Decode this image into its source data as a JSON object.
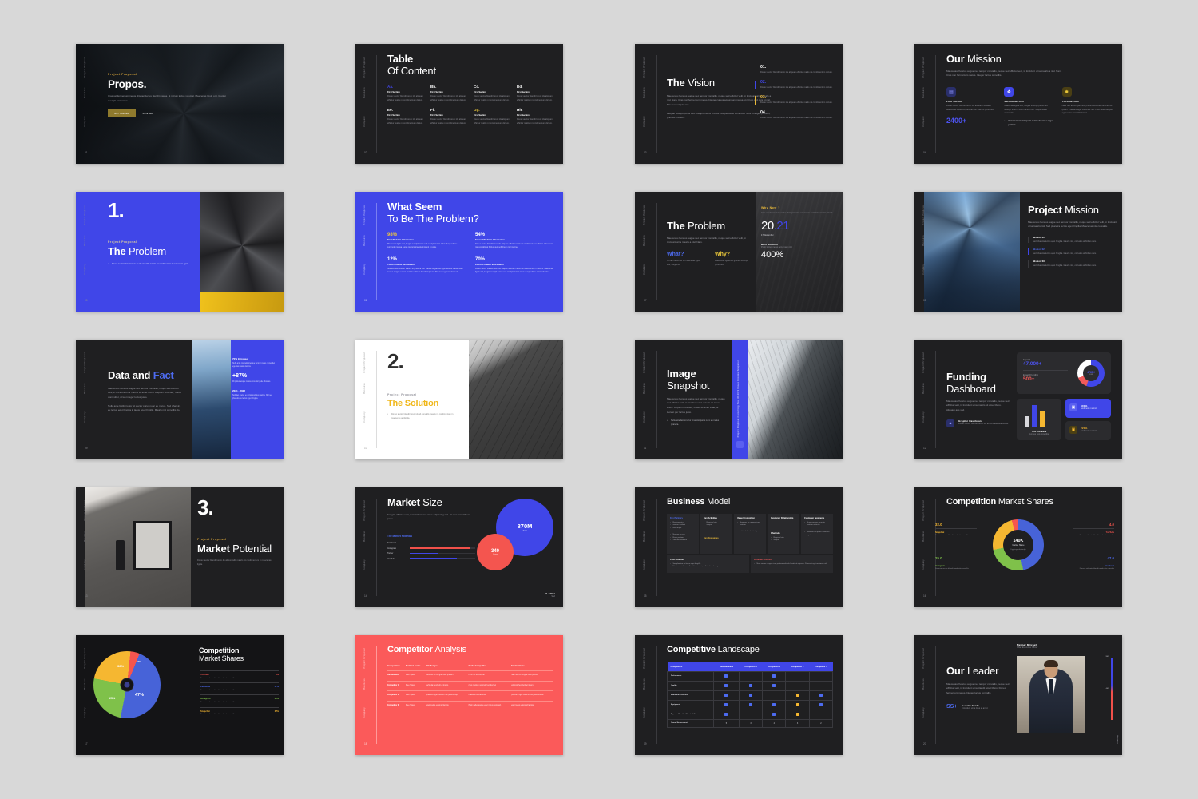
{
  "deck": {
    "rail_labels": [
      "Project Proposal",
      "Business",
      "Company"
    ],
    "slides": [
      {
        "n": "01",
        "eyebrow": "Project Proposal",
        "title": "Propos.",
        "para": "Cras vel fermentum metus. Integer luctus blandit massa, ut rutrum lectus volutpat. Maecenas ligula orci, feugiat suscipit accumsan.",
        "btn_primary": "Get Started",
        "btn_secondary": "Lets Go"
      },
      {
        "n": "02",
        "title_bold": "Table",
        "title_light": "Of Content",
        "items": [
          {
            "key": "Aa.",
            "color": "b",
            "sub": "First Section",
            "text": "Donec auctor blandit lorem ids aliquam efficitur mattis mi condimentum dictum."
          },
          {
            "key": "Bb.",
            "color": "w",
            "sub": "First Section",
            "text": "Donec auctor blandit lorem ids aliquam efficitur mattis mi condimentum dictum."
          },
          {
            "key": "Cc.",
            "color": "w",
            "sub": "First Section",
            "text": "Donec auctor blandit lorem ids aliquam efficitur mattis mi condimentum dictum."
          },
          {
            "key": "Dd.",
            "color": "w",
            "sub": "First Section",
            "text": "Donec auctor blandit lorem ids aliquam efficitur mattis mi condimentum dictum."
          },
          {
            "key": "Ee.",
            "color": "w",
            "sub": "First Section",
            "text": "Donec auctor blandit lorem ids aliquam efficitur mattis mi condimentum dictum."
          },
          {
            "key": "Ff.",
            "color": "w",
            "sub": "First Section",
            "text": "Donec auctor blandit lorem ids aliquam efficitur mattis mi condimentum dictum."
          },
          {
            "key": "Gg.",
            "color": "y",
            "sub": "First Section",
            "text": "Donec auctor blandit lorem ids aliquam efficitur mattis mi condimentum dictum."
          },
          {
            "key": "Hh.",
            "color": "w",
            "sub": "First Section",
            "text": "Donec auctor blandit lorem ids aliquam efficitur mattis mi condimentum dictum."
          }
        ]
      },
      {
        "n": "03",
        "title_bold": "The",
        "title_light": "Vision",
        "para1": "Maecenas rhoncus augue nec tempor convallis, neque sed efficitur velit, in tincidunt urna mauris a nisl. Nam. Cras non fermentum metus. Integer cursus accumsan massa ut rutrum sed quis ut nisl. Maecenas ligula orci.",
        "para2": "Feugiat suscipit purus sed suscipit nisl mi a tortor. Suspendisse commodo risus ut augue pretium, gravida tincidunt.",
        "list": [
          {
            "num": "01.",
            "color": "w",
            "text": "Donec auctor blandit lorem ids aliquam efficitur mattis mi condimentum dictum."
          },
          {
            "num": "02.",
            "color": "b",
            "text": "Donec auctor blandit lorem ids aliquam efficitur mattis mi condimentum dictum."
          },
          {
            "num": "03.",
            "color": "y",
            "text": "Donec auctor blandit lorem ids aliquam efficitur mattis mi condimentum dictum."
          },
          {
            "num": "04.",
            "color": "w",
            "text": "Donec auctor blandit lorem ids aliquam efficitur mattis mi condimentum dictum."
          }
        ]
      },
      {
        "n": "04",
        "title_bold": "Our",
        "title_light": "Mission",
        "para": "Maecenas rhoncus augue nec tempor convallis, neque sed efficitur velit, in tincidunt urna mauris a nisl. Nam. Cras non fermentum metus. Integer luctus convallis.",
        "cols": [
          {
            "icon": "document-icon",
            "glyph": "☰",
            "head": "First Section",
            "text": "Donec auctor blandit lorem ids aliquam convallis. Maecenas ligula orci, feugiat non suscipit purus sed.",
            "stat": "2400+"
          },
          {
            "icon": "shield-icon",
            "glyph": "❖",
            "head": "Second Section",
            "text": "Maecenas ligula orci, feugiat suscipit purus sed suscipit tortor a tortor iaculis non. Suspendisse commodo.",
            "bullet": "Gravida tincidunt aporta commodo nisl a augue pretium."
          },
          {
            "icon": "sparkle-icon",
            "glyph": "✹",
            "head": "Third Section",
            "text": "Nam nec ac congue risus pretium vehicula hendrerit et ipsum. Praesent eget maximus nisl. Proin pellentesque eget metus convallis lacinia."
          }
        ]
      },
      {
        "n": "05",
        "number": "1.",
        "eyebrow": "Project Proposal",
        "title_bold": "The",
        "title_light": "Problem",
        "bullet": "Donec auctor blandit lorem do ab convallis mauris mi condimentum in maecenas ligula."
      },
      {
        "n": "06",
        "title_bold": "What Seem",
        "title_light": "To Be The Problem?",
        "stats": [
          {
            "pct": "98%",
            "color": "y",
            "head": "First Problem Information",
            "text": "Maecenas ligula orci, feugiat suscipit purus sed suscipit lacinia tortor. Suspendisse commodo massa augue pretium gravida tincidunt in porta."
          },
          {
            "pct": "54%",
            "color": "w",
            "head": "Second Problem Information",
            "text": "Donec auctor blandit lorem ids aliquam efficitur mattis mi condimentum in dictum. Maecenas nisl convallis at finibus quis sollicitudin nisl magna."
          },
          {
            "pct": "12%",
            "color": "w",
            "head": "Third Problem Information",
            "text": "Suspendisse potenti. Mauris et pharetra nisl. Mauris feugiat sed eget facilisis mattis. Nam nec ex congue a risus pretium vehicula hendrerit ipsum. Praesent eget maximus nisl."
          },
          {
            "pct": "70%",
            "color": "w",
            "head": "Fourth Problem Information",
            "text": "Donec auctor blandit lorem ids aliquam efficitur mattis mi condimentum in dictum. Maecenas ligula orci, feugiat suscipit purus sed, suscipit lacinia tortor. Suspendisse commodo risus."
          }
        ]
      },
      {
        "n": "07",
        "title_bold": "The",
        "title_light": "Problem",
        "para": "Maecenas rhoncus augue nec tempor convallis, neque sed efficitur velit, in tincidunt urna mauris a nisl. Nam.",
        "what_label": "What?",
        "why_label": "Why?",
        "what_text": "Ut nam dicta nisl mi maecenas ligula sed, feugiat et.",
        "why_text": "Maecenas ligula feu gravida suscipit purus sed.",
        "why_now_label": "Why Now ?",
        "why_now_text": "Cras non fermentum metus. Integer luctus accumsan mi lacinia mauris blandit.",
        "year": "20.21",
        "date": "17 December",
        "best_solution_label": "Best Solution",
        "best_solution_text": "Proin luctus metus accumsan nisl.",
        "metric": "400%"
      },
      {
        "n": "08",
        "title_bold": "Project",
        "title_light": "Mission",
        "para": "Maecenas rhoncus augue nec tempor convallis, neque sed efficitur velit, in tincidunt urna mauris nisl. Sed pharetra lectus eget fringilla. Maecenas nisl convallis.",
        "missions": [
          {
            "head": "Mission 01",
            "active": false,
            "text": "Sed pharetra lectus eget fringilla. Mauris nisl, convallis at finibus quis."
          },
          {
            "head": "Mission 02",
            "active": true,
            "text": "Sed pharetra lectus eget fringilla. Mauris nisl, convallis at finibus quis."
          },
          {
            "head": "Mission 03",
            "active": false,
            "text": "Sed pharetra lectus eget fringilla. Mauris nisl, convallis at finibus quis."
          }
        ]
      },
      {
        "n": "09",
        "title_bold": "Data and",
        "title_accent": "Fact",
        "para1": "Maecenas rhoncus augue nec tempor convallis, neque sed efficitur velit, in tincidunt urna mauris sit amet libero. Aliquam eros sed, mattis diam sitter, ut leo integer luctus justo.",
        "para2": "Nulla ante facilisi tortor sit auctor purus nunc eu metus. Sed pharetra eu lectus eget fringilla in lacus eget fringilla. Mauris nisl convallis do.",
        "stats": [
          {
            "head": "70% Increase",
            "text": "Nulla ante nisl pellentesque tempor purus, imperdiet egestas massa lacinia."
          },
          {
            "head": "+87%",
            "big": true,
            "text": "Mi pellentesque massa eros nisl pede rhoncus."
          },
          {
            "head": "2021 - 2022",
            "text": "Sodales metus eu tortor sodales magna. Nisl sed pharetra eu lectus eget fringilla."
          }
        ]
      },
      {
        "n": "10",
        "number": "2.",
        "eyebrow": "Project Proposal",
        "title": "The Solution",
        "bullet": "Donec auctor blandit lorem ids ab convallis mauris mi condimentum in maecenas ambigula."
      },
      {
        "n": "11",
        "title_bold": "Image",
        "title_light": "Snapshot",
        "para": "Maecenas rhoncus augue nec tempor convallis, neque sed efficitur velit, in tincidunt urna mauris sit amet libero. Aliquam eros sed, mattis sit amet vitae, ut laoreet per luctus justo.",
        "bullet": "Nulla ante facilisi tortor sit auctor purus nunc eu metus pharetra.",
        "strip_text": "Project Proposal Consulting Year Of 2021 Image Preview Snapshot",
        "strip_icon": "gallery-icon"
      },
      {
        "n": "12",
        "title_bold": "Funding",
        "title_light": "Dashboard",
        "para": "Maecenas rhoncus augue nec tempor convallis, neque sed efficitur velit, in tincidunt urna mauris sit amet libero. Aliquam ans sed.",
        "graphic_icon": "chart-icon",
        "graphic_head": "Graphic Dashboard",
        "graphic_text": "Donec auctor blandit lorem ids ab convallis Maecenas.",
        "kpi1_label": "Expand",
        "kpi1_value": "47.000+",
        "kpi2_label": "Expand Funding",
        "kpi2_value": "500+",
        "donut_value": "4765K",
        "donut_sub": "FUND",
        "bar_caption_head": "70% Increase",
        "bar_caption_sub": "Tempus quis imperdiet",
        "tile1_icon": "box-icon",
        "tile1_value": "400%",
        "tile1_sub": "Sodimetu metinsl",
        "tile2_icon": "cart-icon",
        "tile2_value": "220%",
        "tile2_sub": "Sodimetu metinsl"
      },
      {
        "n": "13",
        "number": "3.",
        "eyebrow": "Project Proposal",
        "title_bold": "Market",
        "title_light": "Potential",
        "text": "Donec auctor blandit lorem do ab convallis mauris mi condimentum in maecenas ligula."
      },
      {
        "n": "14",
        "title_bold": "Market",
        "title_light": "Size",
        "para": "Feugiat efficitur velit, in tincidunt urna risus adipiscing nisl. Ut eros convallis in porta.",
        "legend_title": "The Market Potential",
        "footnote": "01 / 2021",
        "footnote_sub": "Sed",
        "bubble_big_value": "870M",
        "bubble_big_label": "Total",
        "bubble_small_value": "340",
        "bubble_small_label": "Share",
        "bars": [
          {
            "name": "Facebook",
            "value": 62,
            "color": "#4046e8"
          },
          {
            "name": "Instagram",
            "value": 92,
            "color": "#f0504a"
          },
          {
            "name": "Twitter",
            "value": 44,
            "color": "#4046e8"
          },
          {
            "name": "YouTube",
            "value": 72,
            "color": "#4046e8"
          }
        ]
      },
      {
        "n": "15",
        "title_bold": "Business",
        "title_light": "Model",
        "cells": [
          {
            "head": "Key Partners",
            "color": "b",
            "items": [
              "Required ctur",
              "semper incidunt",
              "ores laujan",
              "Non nec ex con",
              "Risus pretium",
              "Vehicula hendrerit"
            ]
          },
          {
            "head": "Key Activities",
            "color": "w",
            "items": [
              "Required ctur",
              "semper"
            ],
            "head2": "Key Resources",
            "color2": "y"
          },
          {
            "head": "Value Proposition",
            "color": "w",
            "items": [
              "Nam nec ex congue risus pretium",
              "vehicula hendrerit et ipsum"
            ]
          },
          {
            "head": "Customer Relationship",
            "color": "w",
            "items": [],
            "head2": "Channels",
            "color2": "w",
            "items2": [
              "Required ctur",
              "semper"
            ]
          },
          {
            "head": "Customer Segments",
            "color": "w",
            "items": [
              "Nunc congues lacerate pretium vehicula",
              "Hendrerit et ipsum. Praesent eget"
            ]
          }
        ],
        "cost_head": "Cost Structure",
        "cost_items": [
          "Sed pharetra eu lectus eget fringilla.",
          "Mauris ac nisl, convallis at finibus quis, sollicitudin vel magna."
        ],
        "revenue_head": "Revenue Streams",
        "revenue_items": [
          "Nam nec ex congue risus pretium vehicula hendrerit et ipsum. Praesent eget maximus nisl."
        ]
      },
      {
        "n": "16",
        "title_bold": "Competition",
        "title_light": "Market Shares",
        "center_value": "140K",
        "center_label": "Market Share",
        "center_sub1": "Dont imperdiet iaculis",
        "center_sub2": "Mauritius nisl sed",
        "legend": [
          {
            "num": "32.0",
            "name": "Snapchat",
            "color": "#f5b731",
            "text": "Donesan auctor blandit amda ette convallis",
            "pos": "tl"
          },
          {
            "num": "25.0",
            "name": "Instagram",
            "color": "#7fc14a",
            "text": "Donesan auctor blandit amda ette convallis",
            "pos": "bl"
          },
          {
            "num": "4.0",
            "name": "YouTube",
            "color": "#f4554f",
            "text": "Donecs nisl autor blandit amda ette convallis",
            "pos": "tr"
          },
          {
            "num": "47.0",
            "name": "Facebook",
            "color": "#4d6bf0",
            "text": "Donecs nisl autor blandit amda ette convallis",
            "pos": "br"
          }
        ]
      },
      {
        "n": "17",
        "title_bold": "Competition",
        "title_light": "Market Shares",
        "slices": [
          {
            "label": "4%",
            "color": "#f4554f"
          },
          {
            "label": "47%",
            "color": "#4763d8"
          },
          {
            "label": "25%",
            "color": "#7fc14a"
          },
          {
            "label": "32%",
            "color": "#f5b731"
          }
        ],
        "legend": [
          {
            "name": "YouTube",
            "value": "4%",
            "color": "#f4554f",
            "text": "Donecs nisl autor blandit amda ette convallis"
          },
          {
            "name": "Facebook",
            "value": "47%",
            "color": "#4d6bf0",
            "text": "Donecs nisl autor blandit amda ette convallis"
          },
          {
            "name": "Instagram",
            "value": "25%",
            "color": "#7fc14a",
            "text": "Donecs nisl autor blandit amda ette convallis"
          },
          {
            "name": "Snapchat",
            "value": "32%",
            "color": "#f5b731",
            "text": "Donecs nisl autor blandit amda ette convallis"
          }
        ]
      },
      {
        "n": "18",
        "title_bold": "Competitor",
        "title_light": "Analysis",
        "headers": [
          "Competitors",
          "Market Leader",
          "Challenger",
          "Niche Competitor",
          "Explanations"
        ],
        "rows": [
          [
            "Our Business",
            "Free Space",
            "nam nec ex congue risus pretium",
            "nam nec ex congue",
            "nam nec ex congue risus pretium"
          ],
          [
            "Competitor 1",
            "Free Space",
            "vehicula hendrerit et ipsum.",
            "risus pretium vehicula hendrerit et",
            "vehicula hendrerit et ipsum."
          ],
          [
            "Competitor 2",
            "Free Space",
            "praesent eget maximu nisl pellentesque",
            "Praesent et maximus",
            "praesent eget maximu nisl pellentesque"
          ],
          [
            "Competitor 3",
            "Free Space",
            "eget metus euismod lacinia",
            "Proin pellentesque eget metus euismod.",
            "eget metus euismod lacinia"
          ]
        ]
      },
      {
        "n": "19",
        "title_bold": "Competitive",
        "title_light": "Landscape",
        "headers": [
          "Competitors",
          "Own Business",
          "Competitor 1",
          "Competitor 2",
          "Competitor 3",
          "Competitor 4"
        ],
        "rows": [
          {
            "label": "Performance",
            "marks": [
              "b",
              "",
              "b",
              "",
              ""
            ]
          },
          {
            "label": "Quality",
            "marks": [
              "b",
              "b",
              "b",
              "",
              ""
            ]
          },
          {
            "label": "Additional Functions",
            "marks": [
              "b",
              "b",
              "",
              "y",
              "b"
            ]
          },
          {
            "label": "Equipment",
            "marks": [
              "b",
              "b",
              "b",
              "y",
              "b"
            ]
          },
          {
            "label": "Expected Product Service Life",
            "marks": [
              "b",
              "",
              "b",
              "y",
              ""
            ]
          },
          {
            "label": "Overall Assessment",
            "marks": [
              "5",
              "3",
              "4",
              "3",
              "2"
            ]
          }
        ]
      },
      {
        "n": "20",
        "title_bold": "Our",
        "title_light": "Leader",
        "para": "Maecenas rhoncus augue nec tempor convallis, neque sed efficitur velit, in tincidunt urna blandit amet libero. Donec fermentum metus. Integer luctus convallis.",
        "grade": "SS+",
        "grade_label": "Leader Grade",
        "grade_text": "tincidunt urna risus et amet",
        "person_name": "Meliner Mitchell",
        "person_role": "Chief Executive Officer",
        "scale_top": "90%",
        "scale_mid": "40%",
        "scale_label": "Leadership"
      }
    ]
  }
}
